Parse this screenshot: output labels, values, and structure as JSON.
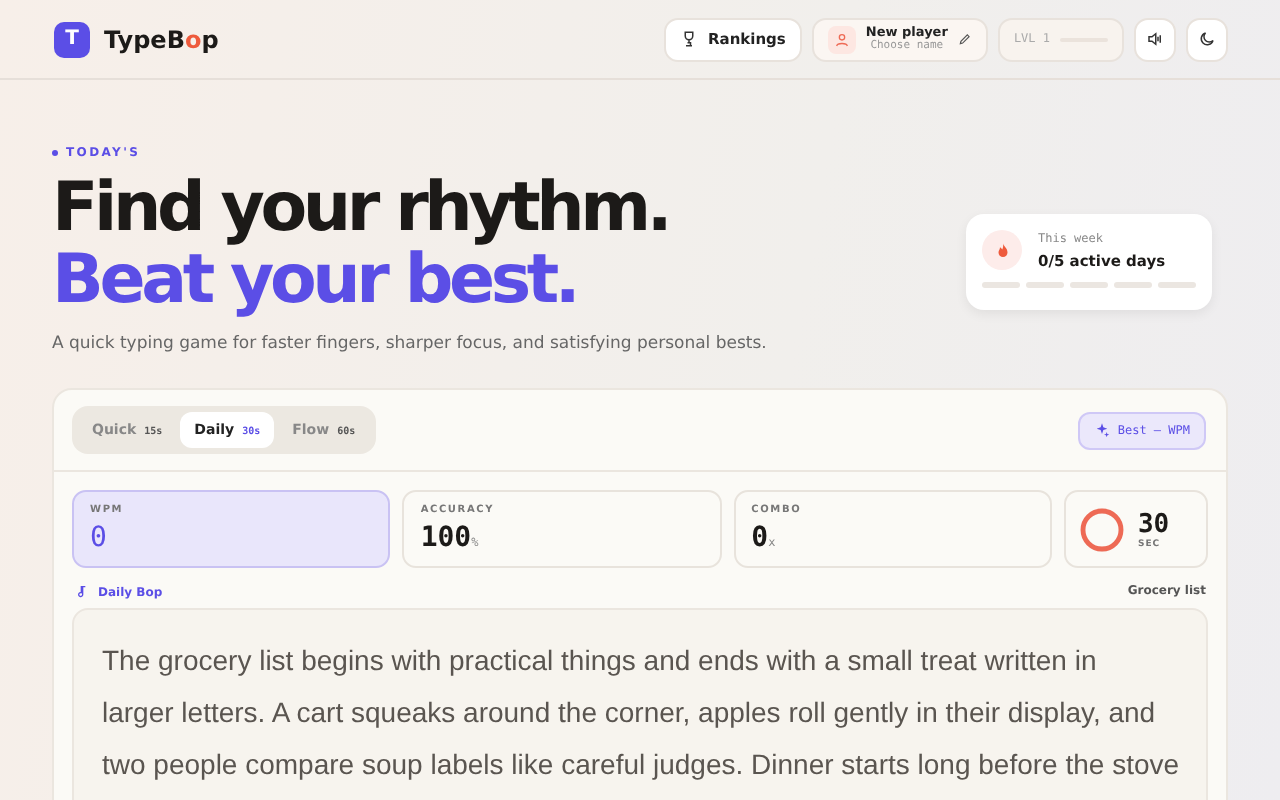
{
  "header": {
    "logo_letter": "T",
    "brand": [
      "TypeB",
      "o",
      "p"
    ],
    "rankings": "Rankings",
    "player": {
      "name": "New player",
      "hint": "Choose name"
    },
    "level": {
      "label": "LVL 1",
      "level": 0
    }
  },
  "hero": {
    "eyebrow": "TODAY'S",
    "line1": "Find your rhythm.",
    "line2": "Beat your best.",
    "subtitle": "A quick typing game for faster fingers, sharper focus, and satisfying personal bests."
  },
  "week": {
    "label": "This week",
    "value": "0/5 active days",
    "days": [
      {
        "active": false
      },
      {
        "active": false
      },
      {
        "active": false
      },
      {
        "active": false
      },
      {
        "active": false
      }
    ]
  },
  "game": {
    "modes": [
      {
        "label": "Quick",
        "time": "15s",
        "selected": false
      },
      {
        "label": "Daily",
        "time": "30s",
        "selected": true
      },
      {
        "label": "Flow",
        "time": "60s",
        "selected": false
      }
    ],
    "best": "Best — WPM",
    "stats": [
      {
        "label": "WPM",
        "value": "0",
        "highlighted": true
      },
      {
        "label": "ACCURACY",
        "value": "100",
        "unit": "%",
        "highlighted": false
      },
      {
        "label": "COMBO",
        "value": "0",
        "unit": "x",
        "highlighted": false
      }
    ],
    "timer": {
      "value": "30",
      "unit": "SEC",
      "level": 1
    },
    "track": "Daily Bop",
    "passage_title": "Grocery list",
    "passage_lines": [
      "The grocery list begins with practical things and ends with a small treat written in",
      "larger letters. A cart squeaks around the corner, apples roll gently in their display, and",
      "two people compare soup labels like careful judges. Dinner starts long before the stove"
    ]
  }
}
